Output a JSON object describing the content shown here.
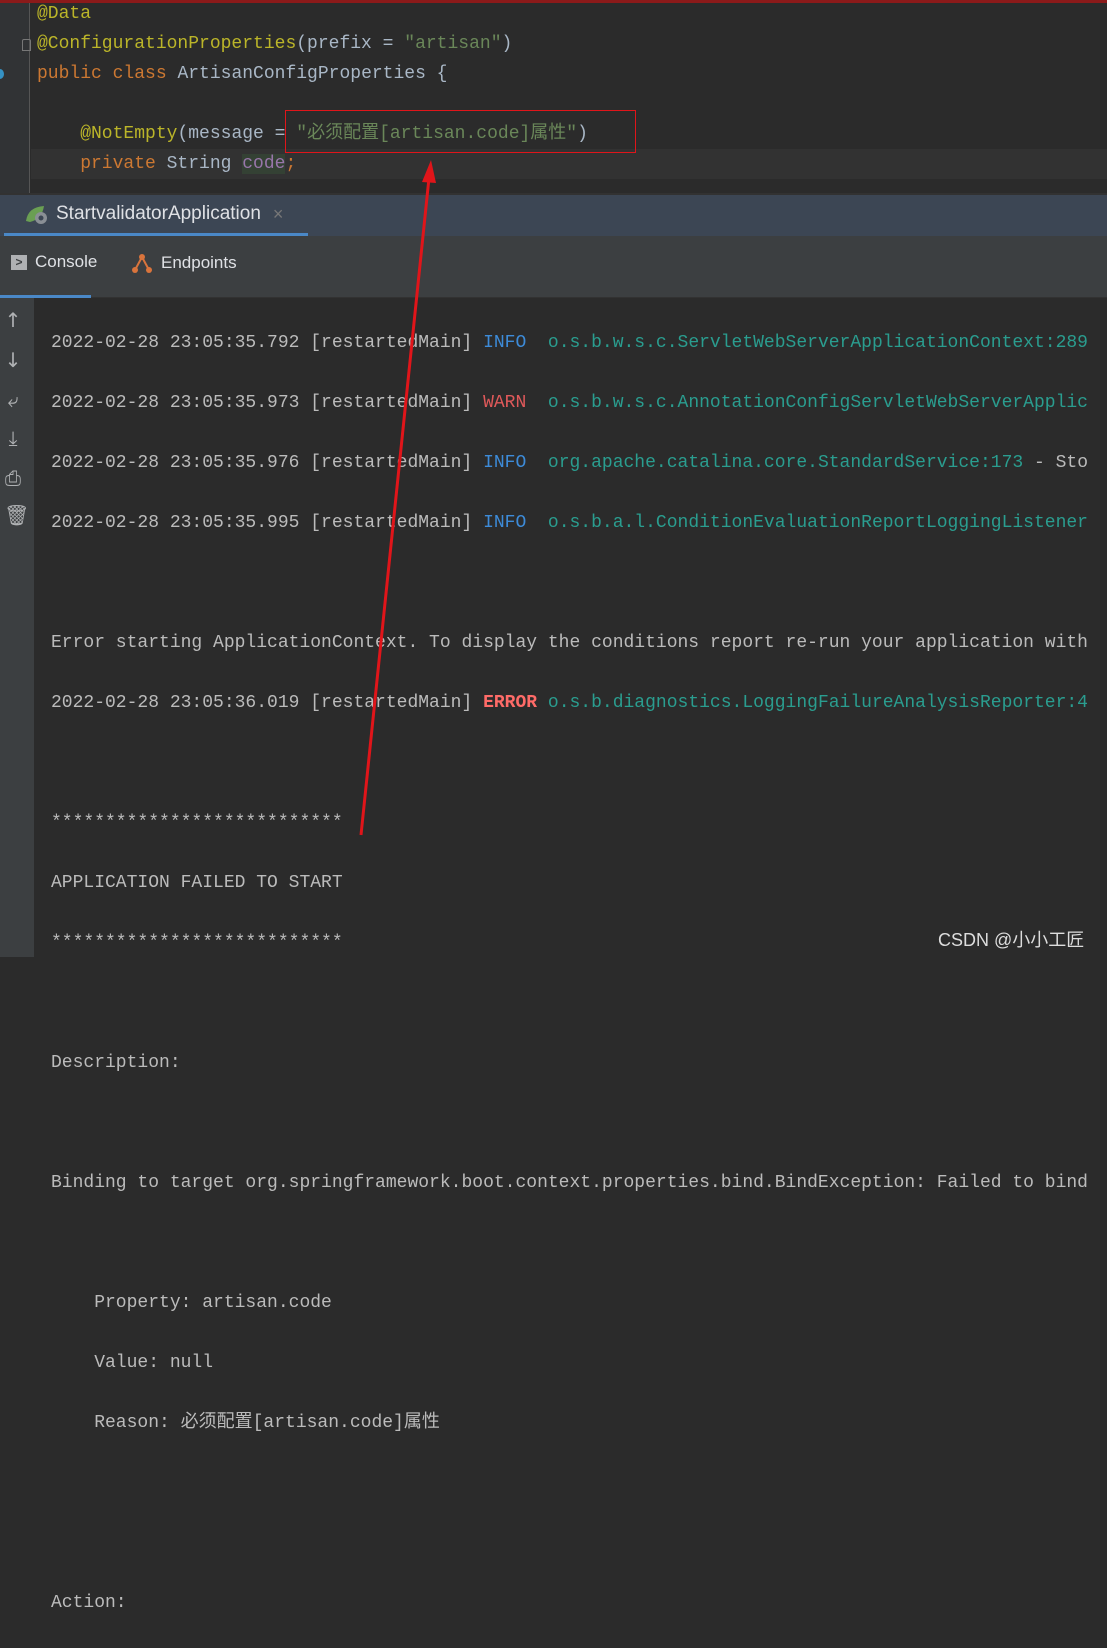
{
  "editor": {
    "lines": {
      "l1": "@Data",
      "l2a": "@ConfigurationProperties",
      "l2b": "(prefix = ",
      "l2c": "\"artisan\"",
      "l2d": ")",
      "l3a": "public class ",
      "l3b": "ArtisanConfigProperties {",
      "l5a": "    @NotEmpty",
      "l5b": "(message = ",
      "l5c": "\"必须配置[artisan.code]属性\"",
      "l5d": ")",
      "l6a": "    private ",
      "l6b": "String ",
      "l6c": "code",
      "l6d": ";"
    }
  },
  "run_tab": {
    "label": "StartvalidatorApplication",
    "close": "×"
  },
  "tool_tabs": {
    "console": "Console",
    "endpoints": "Endpoints"
  },
  "console": {
    "logs": [
      {
        "ts": "2022-02-28 23:05:35.792 [restartedMain] ",
        "level": "INFO ",
        "cls": " o.s.b.w.s.c.ServletWebServerApplicationContext:289",
        "rest": ""
      },
      {
        "ts": "2022-02-28 23:05:35.973 [restartedMain] ",
        "level": "WARN ",
        "cls": " o.s.b.w.s.c.AnnotationConfigServletWebServerApplic",
        "rest": ""
      },
      {
        "ts": "2022-02-28 23:05:35.976 [restartedMain] ",
        "level": "INFO ",
        "cls": " org.apache.catalina.core.StandardService:173",
        "rest": " - Sto"
      },
      {
        "ts": "2022-02-28 23:05:35.995 [restartedMain] ",
        "level": "INFO ",
        "cls": " o.s.b.a.l.ConditionEvaluationReportLoggingListener",
        "rest": ""
      }
    ],
    "error_start": "Error starting ApplicationContext. To display the conditions report re-run your application with",
    "error_log": {
      "ts": "2022-02-28 23:05:36.019 [restartedMain] ",
      "level": "ERROR",
      "cls": " o.s.b.diagnostics.LoggingFailureAnalysisReporter:4"
    },
    "stars": "***************************",
    "failed": "APPLICATION FAILED TO START",
    "description": "Description:",
    "binding": "Binding to target org.springframework.boot.context.properties.bind.BindException: Failed to bind",
    "property": "    Property: artisan.code",
    "value": "    Value: null",
    "reason": "    Reason: 必须配置[artisan.code]属性",
    "action": "Action:"
  },
  "watermark": "CSDN @小小工匠",
  "colors": {
    "annotation_box": "#e0151a",
    "arrow": "#e0151a"
  }
}
